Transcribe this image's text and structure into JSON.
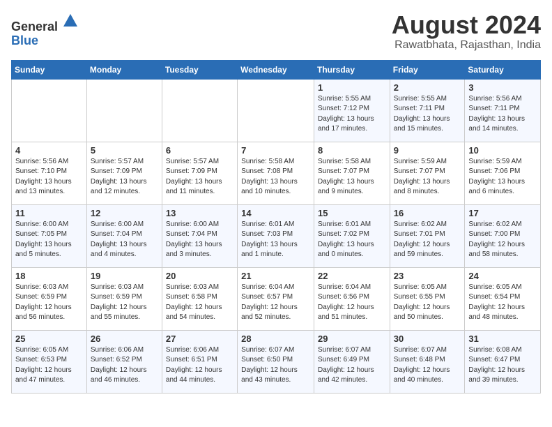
{
  "header": {
    "logo_line1": "General",
    "logo_line2": "Blue",
    "month_year": "August 2024",
    "location": "Rawatbhata, Rajasthan, India"
  },
  "weekdays": [
    "Sunday",
    "Monday",
    "Tuesday",
    "Wednesday",
    "Thursday",
    "Friday",
    "Saturday"
  ],
  "weeks": [
    [
      {
        "day": "",
        "info": ""
      },
      {
        "day": "",
        "info": ""
      },
      {
        "day": "",
        "info": ""
      },
      {
        "day": "",
        "info": ""
      },
      {
        "day": "1",
        "info": "Sunrise: 5:55 AM\nSunset: 7:12 PM\nDaylight: 13 hours\nand 17 minutes."
      },
      {
        "day": "2",
        "info": "Sunrise: 5:55 AM\nSunset: 7:11 PM\nDaylight: 13 hours\nand 15 minutes."
      },
      {
        "day": "3",
        "info": "Sunrise: 5:56 AM\nSunset: 7:11 PM\nDaylight: 13 hours\nand 14 minutes."
      }
    ],
    [
      {
        "day": "4",
        "info": "Sunrise: 5:56 AM\nSunset: 7:10 PM\nDaylight: 13 hours\nand 13 minutes."
      },
      {
        "day": "5",
        "info": "Sunrise: 5:57 AM\nSunset: 7:09 PM\nDaylight: 13 hours\nand 12 minutes."
      },
      {
        "day": "6",
        "info": "Sunrise: 5:57 AM\nSunset: 7:09 PM\nDaylight: 13 hours\nand 11 minutes."
      },
      {
        "day": "7",
        "info": "Sunrise: 5:58 AM\nSunset: 7:08 PM\nDaylight: 13 hours\nand 10 minutes."
      },
      {
        "day": "8",
        "info": "Sunrise: 5:58 AM\nSunset: 7:07 PM\nDaylight: 13 hours\nand 9 minutes."
      },
      {
        "day": "9",
        "info": "Sunrise: 5:59 AM\nSunset: 7:07 PM\nDaylight: 13 hours\nand 8 minutes."
      },
      {
        "day": "10",
        "info": "Sunrise: 5:59 AM\nSunset: 7:06 PM\nDaylight: 13 hours\nand 6 minutes."
      }
    ],
    [
      {
        "day": "11",
        "info": "Sunrise: 6:00 AM\nSunset: 7:05 PM\nDaylight: 13 hours\nand 5 minutes."
      },
      {
        "day": "12",
        "info": "Sunrise: 6:00 AM\nSunset: 7:04 PM\nDaylight: 13 hours\nand 4 minutes."
      },
      {
        "day": "13",
        "info": "Sunrise: 6:00 AM\nSunset: 7:04 PM\nDaylight: 13 hours\nand 3 minutes."
      },
      {
        "day": "14",
        "info": "Sunrise: 6:01 AM\nSunset: 7:03 PM\nDaylight: 13 hours\nand 1 minute."
      },
      {
        "day": "15",
        "info": "Sunrise: 6:01 AM\nSunset: 7:02 PM\nDaylight: 13 hours\nand 0 minutes."
      },
      {
        "day": "16",
        "info": "Sunrise: 6:02 AM\nSunset: 7:01 PM\nDaylight: 12 hours\nand 59 minutes."
      },
      {
        "day": "17",
        "info": "Sunrise: 6:02 AM\nSunset: 7:00 PM\nDaylight: 12 hours\nand 58 minutes."
      }
    ],
    [
      {
        "day": "18",
        "info": "Sunrise: 6:03 AM\nSunset: 6:59 PM\nDaylight: 12 hours\nand 56 minutes."
      },
      {
        "day": "19",
        "info": "Sunrise: 6:03 AM\nSunset: 6:59 PM\nDaylight: 12 hours\nand 55 minutes."
      },
      {
        "day": "20",
        "info": "Sunrise: 6:03 AM\nSunset: 6:58 PM\nDaylight: 12 hours\nand 54 minutes."
      },
      {
        "day": "21",
        "info": "Sunrise: 6:04 AM\nSunset: 6:57 PM\nDaylight: 12 hours\nand 52 minutes."
      },
      {
        "day": "22",
        "info": "Sunrise: 6:04 AM\nSunset: 6:56 PM\nDaylight: 12 hours\nand 51 minutes."
      },
      {
        "day": "23",
        "info": "Sunrise: 6:05 AM\nSunset: 6:55 PM\nDaylight: 12 hours\nand 50 minutes."
      },
      {
        "day": "24",
        "info": "Sunrise: 6:05 AM\nSunset: 6:54 PM\nDaylight: 12 hours\nand 48 minutes."
      }
    ],
    [
      {
        "day": "25",
        "info": "Sunrise: 6:05 AM\nSunset: 6:53 PM\nDaylight: 12 hours\nand 47 minutes."
      },
      {
        "day": "26",
        "info": "Sunrise: 6:06 AM\nSunset: 6:52 PM\nDaylight: 12 hours\nand 46 minutes."
      },
      {
        "day": "27",
        "info": "Sunrise: 6:06 AM\nSunset: 6:51 PM\nDaylight: 12 hours\nand 44 minutes."
      },
      {
        "day": "28",
        "info": "Sunrise: 6:07 AM\nSunset: 6:50 PM\nDaylight: 12 hours\nand 43 minutes."
      },
      {
        "day": "29",
        "info": "Sunrise: 6:07 AM\nSunset: 6:49 PM\nDaylight: 12 hours\nand 42 minutes."
      },
      {
        "day": "30",
        "info": "Sunrise: 6:07 AM\nSunset: 6:48 PM\nDaylight: 12 hours\nand 40 minutes."
      },
      {
        "day": "31",
        "info": "Sunrise: 6:08 AM\nSunset: 6:47 PM\nDaylight: 12 hours\nand 39 minutes."
      }
    ]
  ]
}
